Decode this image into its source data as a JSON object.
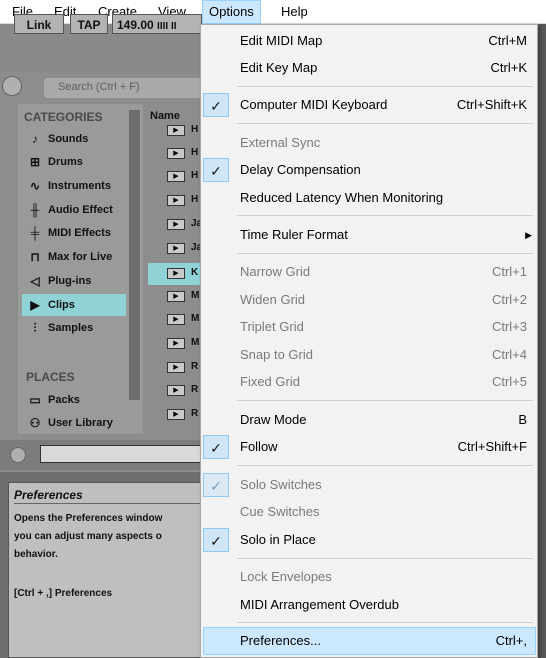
{
  "menubar": {
    "items": [
      "File",
      "Edit",
      "Create",
      "View",
      "Options",
      "Help"
    ]
  },
  "transport": {
    "link": "Link",
    "tap": "TAP",
    "tempo": "149.00",
    "meter": "IIII II"
  },
  "browser": {
    "search_placeholder": "Search (Ctrl + F)",
    "categories_heading": "CATEGORIES",
    "name_heading": "Name",
    "categories": [
      {
        "label": "Sounds",
        "icon": "music-note-icon"
      },
      {
        "label": "Drums",
        "icon": "drum-grid-icon"
      },
      {
        "label": "Instruments",
        "icon": "waveform-icon"
      },
      {
        "label": "Audio Effect",
        "icon": "audio-effect-icon"
      },
      {
        "label": "MIDI Effects",
        "icon": "midi-effect-icon"
      },
      {
        "label": "Max for Live",
        "icon": "max-for-live-icon"
      },
      {
        "label": "Plug-ins",
        "icon": "plugin-icon"
      },
      {
        "label": "Clips",
        "icon": "clip-play-icon"
      },
      {
        "label": "Samples",
        "icon": "sample-wave-icon"
      }
    ],
    "clip_rows": [
      "H",
      "H",
      "H",
      "H",
      "Ja",
      "Ja",
      "K",
      "M",
      "M",
      "M",
      "R",
      "R",
      "R"
    ],
    "places_heading": "PLACES",
    "places": [
      {
        "label": "Packs",
        "icon": "packs-icon"
      },
      {
        "label": "User Library",
        "icon": "user-library-icon"
      }
    ]
  },
  "info": {
    "title": "Preferences",
    "lines": [
      "Opens the Preferences window",
      "you can adjust many aspects o",
      "behavior.",
      "",
      "[Ctrl + ,] Preferences"
    ]
  },
  "options_menu": {
    "items": [
      {
        "label": "Edit MIDI Map",
        "shortcut": "Ctrl+M"
      },
      {
        "label": "Edit Key Map",
        "shortcut": "Ctrl+K"
      },
      {
        "label": "Computer MIDI Keyboard",
        "shortcut": "Ctrl+Shift+K"
      },
      {
        "label": "External Sync",
        "shortcut": ""
      },
      {
        "label": "Delay Compensation",
        "shortcut": ""
      },
      {
        "label": "Reduced Latency When Monitoring",
        "shortcut": ""
      },
      {
        "label": "Time Ruler Format",
        "shortcut": ""
      },
      {
        "label": "Narrow Grid",
        "shortcut": "Ctrl+1"
      },
      {
        "label": "Widen Grid",
        "shortcut": "Ctrl+2"
      },
      {
        "label": "Triplet Grid",
        "shortcut": "Ctrl+3"
      },
      {
        "label": "Snap to Grid",
        "shortcut": "Ctrl+4"
      },
      {
        "label": "Fixed Grid",
        "shortcut": "Ctrl+5"
      },
      {
        "label": "Draw Mode",
        "shortcut": "B"
      },
      {
        "label": "Follow",
        "shortcut": "Ctrl+Shift+F"
      },
      {
        "label": "Solo Switches",
        "shortcut": ""
      },
      {
        "label": "Cue Switches",
        "shortcut": ""
      },
      {
        "label": "Solo in Place",
        "shortcut": ""
      },
      {
        "label": "Lock Envelopes",
        "shortcut": ""
      },
      {
        "label": "MIDI Arrangement Overdub",
        "shortcut": ""
      },
      {
        "label": "Preferences...",
        "shortcut": "Ctrl+,"
      }
    ]
  },
  "colors": {
    "menu_highlight": "#cce8ff",
    "menu_highlight_border": "#99d1ff",
    "clips_selected": "#8fd3d7",
    "disabled_text": "#7a7a7a"
  }
}
